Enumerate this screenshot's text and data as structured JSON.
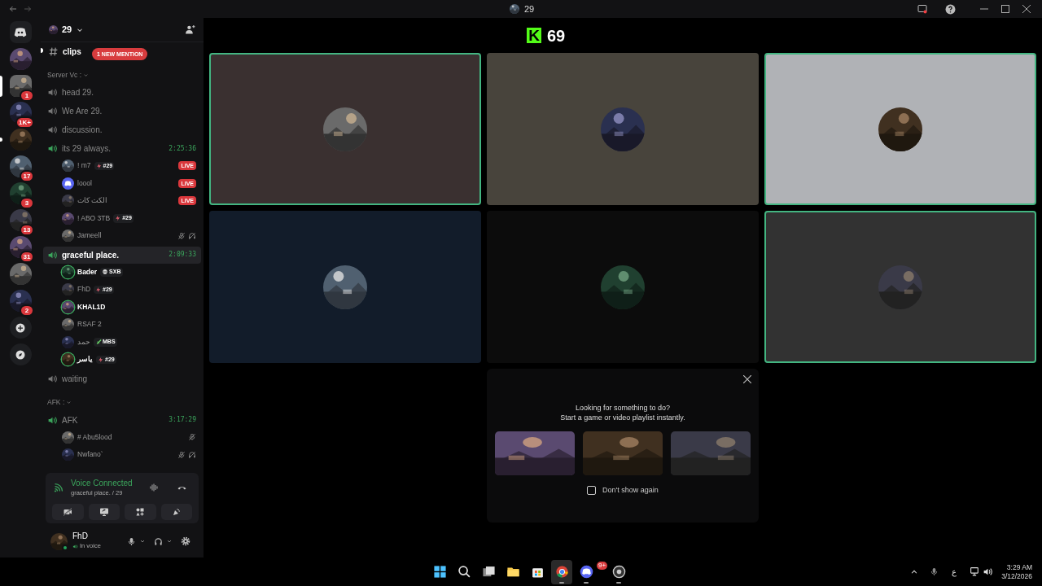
{
  "titlebar": {
    "title": "29"
  },
  "servers": [
    {
      "kind": "home",
      "selected": false,
      "unread": false
    },
    {
      "kind": "server",
      "selected": false,
      "unread": false
    },
    {
      "kind": "server",
      "selected": true,
      "unread": false,
      "badge": "1"
    },
    {
      "kind": "server",
      "selected": false,
      "unread": false,
      "badge": "1K+"
    },
    {
      "kind": "server",
      "selected": false,
      "unread": true
    },
    {
      "kind": "server",
      "selected": false,
      "unread": false,
      "badge": "17"
    },
    {
      "kind": "server",
      "selected": false,
      "unread": false,
      "badge": "3"
    },
    {
      "kind": "server",
      "selected": false,
      "unread": false,
      "badge": "13"
    },
    {
      "kind": "server",
      "selected": false,
      "unread": false,
      "badge": "31"
    },
    {
      "kind": "server",
      "selected": false,
      "unread": false
    },
    {
      "kind": "server",
      "selected": false,
      "unread": false,
      "badge": "2"
    },
    {
      "kind": "add",
      "selected": false,
      "unread": false
    },
    {
      "kind": "discover",
      "selected": false,
      "unread": false
    }
  ],
  "server_header": {
    "name": "29"
  },
  "mention_badge": "1 NEW MENTION",
  "sections": [
    {
      "kind": "text",
      "name": "clips",
      "unread": true
    },
    {
      "kind": "category",
      "name": "Server Vc :"
    },
    {
      "kind": "voice",
      "name": "head 29.",
      "selected": false,
      "active": false
    },
    {
      "kind": "voice",
      "name": "We Are 29.",
      "selected": false,
      "active": false
    },
    {
      "kind": "voice",
      "name": "discussion.",
      "selected": false,
      "active": false
    },
    {
      "kind": "voice",
      "name": "its 29 always.",
      "selected": false,
      "active": true,
      "timer": "2:25:36",
      "users": [
        {
          "name": "! m7",
          "speaking": false,
          "tag": {
            "label": "#29",
            "kind": "bolt"
          },
          "status_badge": "LIVE",
          "muted": false,
          "deafened": false
        },
        {
          "name": "loool",
          "kind": "default",
          "speaking": false,
          "status_badge": "LIVE",
          "muted": false,
          "deafened": false
        },
        {
          "name": "الكت كات",
          "speaking": false,
          "status_badge": "LIVE",
          "muted": false,
          "deafened": false
        },
        {
          "name": "! ABO 3TB",
          "speaking": false,
          "tag": {
            "label": "#29",
            "kind": "bolt"
          },
          "muted": false,
          "deafened": false
        },
        {
          "name": "Jameell",
          "speaking": false,
          "muted": true,
          "deafened": true
        }
      ]
    },
    {
      "kind": "voice",
      "name": "graceful place.",
      "selected": true,
      "active": true,
      "timer": "2:09:33",
      "users": [
        {
          "name": "Bader",
          "speaking": true,
          "tag": {
            "label": "SXB",
            "kind": "skull"
          },
          "muted": false,
          "deafened": false
        },
        {
          "name": "FhD",
          "speaking": false,
          "tag": {
            "label": "#29",
            "kind": "bolt"
          },
          "muted": false,
          "deafened": false
        },
        {
          "name": "KHAL1D",
          "speaking": true,
          "muted": false,
          "deafened": false
        },
        {
          "name": "RSAF 2",
          "speaking": false,
          "muted": false,
          "deafened": false
        },
        {
          "name": "حمد",
          "speaking": false,
          "tag": {
            "label": "MBS",
            "kind": "sword"
          },
          "muted": false,
          "deafened": false
        },
        {
          "name": "ياسر",
          "speaking": true,
          "tag": {
            "label": "#29",
            "kind": "bolt"
          },
          "muted": false,
          "deafened": false
        }
      ]
    },
    {
      "kind": "voice",
      "name": "waiting",
      "selected": false,
      "active": false
    },
    {
      "kind": "category",
      "name": "AFK :"
    },
    {
      "kind": "voice",
      "name": "AFK",
      "selected": false,
      "active": true,
      "timer": "3:17:29",
      "users": [
        {
          "name": "# Abu5lood",
          "speaking": false,
          "muted": true,
          "deafened": false
        },
        {
          "name": "Nwfano`",
          "speaking": false,
          "muted": true,
          "deafened": true
        }
      ]
    }
  ],
  "voice_panel": {
    "status": "Voice Connected",
    "channel": "graceful place. / 29"
  },
  "user_panel": {
    "name": "FhD",
    "status": "In voice"
  },
  "stream_header": {
    "logo": "K",
    "title": "69"
  },
  "tiles": [
    {
      "color": "#3a3030",
      "speaking": true
    },
    {
      "color": "#48443c",
      "speaking": false
    },
    {
      "color": "#b0b2b6",
      "speaking": true
    },
    {
      "color": "#121c2a",
      "speaking": false
    },
    {
      "color": "#0c0c0c",
      "speaking": false
    },
    {
      "color": "#323232",
      "speaking": true
    }
  ],
  "activity_panel": {
    "lines": [
      "Looking for something to do?",
      "Start a game or video playlist instantly."
    ],
    "activities": [
      {
        "kind": "picture"
      },
      {
        "kind": "picture"
      },
      {
        "kind": "picture"
      }
    ],
    "dont_show": {
      "label": "Don't show again",
      "checked": false
    }
  },
  "taskbar": {
    "apps": [
      {
        "kind": "start",
        "selected": false,
        "running": false
      },
      {
        "kind": "search",
        "selected": false,
        "running": false
      },
      {
        "kind": "taskview",
        "selected": false,
        "running": false
      },
      {
        "kind": "files",
        "selected": false,
        "running": false
      },
      {
        "kind": "store",
        "selected": false,
        "running": false
      },
      {
        "kind": "browser",
        "selected": true,
        "running": true
      },
      {
        "kind": "chat",
        "selected": false,
        "running": true,
        "badge": "9+"
      },
      {
        "kind": "recorder",
        "selected": false,
        "running": true
      }
    ],
    "input_language": "ع",
    "time": "3:29 AM",
    "date": "3/12/2026"
  }
}
